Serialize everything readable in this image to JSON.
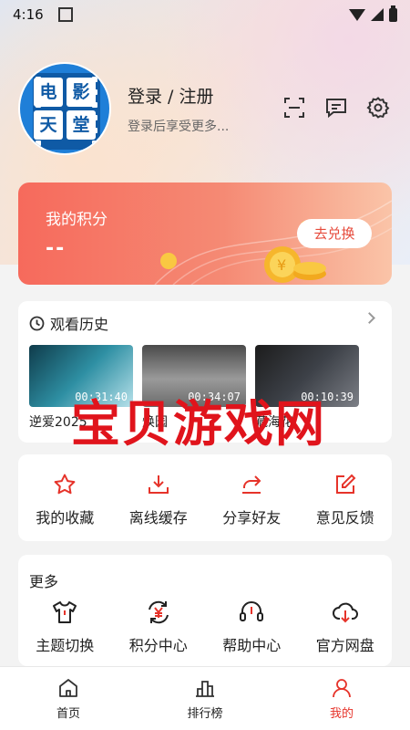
{
  "status_bar": {
    "time": "4:16"
  },
  "profile": {
    "logo_chars": [
      "电",
      "影",
      "天",
      "堂"
    ],
    "login_title": "登录 / 注册",
    "login_subtitle": "登录后享受更多..."
  },
  "points": {
    "label": "我的积分",
    "value": "--",
    "redeem_button": "去兑换"
  },
  "history": {
    "title": "观看历史",
    "items": [
      {
        "title": "逆爱2025",
        "time": "00:31:40"
      },
      {
        "title": "焕园",
        "time": "00:34:07"
      },
      {
        "title": "藏海花",
        "time": "00:10:39"
      }
    ]
  },
  "quick_actions": [
    {
      "label": "我的收藏",
      "icon": "star-icon"
    },
    {
      "label": "离线缓存",
      "icon": "download-icon"
    },
    {
      "label": "分享好友",
      "icon": "share-icon"
    },
    {
      "label": "意见反馈",
      "icon": "edit-icon"
    }
  ],
  "more": {
    "title": "更多",
    "items": [
      {
        "label": "主题切换",
        "icon": "tshirt-icon"
      },
      {
        "label": "积分中心",
        "icon": "yuan-refresh-icon"
      },
      {
        "label": "帮助中心",
        "icon": "headset-icon"
      },
      {
        "label": "官方网盘",
        "icon": "cloud-download-icon"
      }
    ]
  },
  "watermark": "宝贝游戏网",
  "bottom_nav": [
    {
      "label": "首页",
      "icon": "home-icon"
    },
    {
      "label": "排行榜",
      "icon": "ranking-icon"
    },
    {
      "label": "我的",
      "icon": "user-icon"
    }
  ],
  "colors": {
    "accent": "#e6332a",
    "brand_blue": "#1f7fd8"
  }
}
